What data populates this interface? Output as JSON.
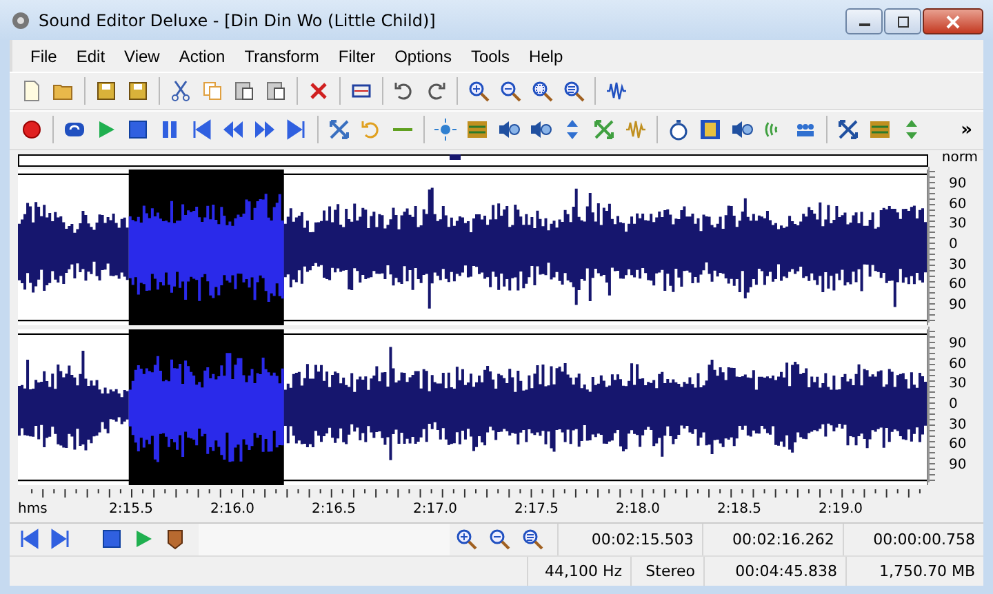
{
  "window": {
    "title": "Sound Editor Deluxe - [Din Din Wo (Little Child)]"
  },
  "menu": [
    "File",
    "Edit",
    "View",
    "Action",
    "Transform",
    "Filter",
    "Options",
    "Tools",
    "Help"
  ],
  "toolbar_overflow": "»",
  "scale": {
    "header": "norm",
    "channels": [
      {
        "ticks": [
          "90",
          "60",
          "30",
          "0",
          "30",
          "60",
          "90"
        ]
      },
      {
        "ticks": [
          "90",
          "60",
          "30",
          "0",
          "30",
          "60",
          "90"
        ]
      }
    ]
  },
  "time_ruler": {
    "unit": "hms",
    "labels": [
      "2:15.5",
      "2:16.0",
      "2:16.5",
      "2:17.0",
      "2:17.5",
      "2:18.0",
      "2:18.5",
      "2:19.0"
    ]
  },
  "selection_times": [
    "00:02:15.503",
    "00:02:16.262",
    "00:00:00.758"
  ],
  "status_bar": [
    "44,100 Hz",
    "Stereo",
    "00:04:45.838",
    "1,750.70 MB"
  ]
}
